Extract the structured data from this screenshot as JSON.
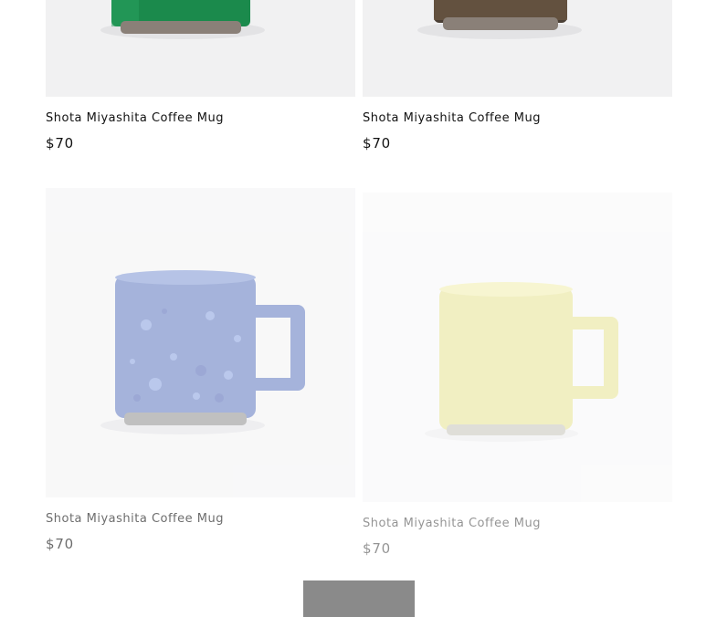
{
  "products": [
    {
      "title": "Shota Miyashita Coffee Mug",
      "price": "$70",
      "glaze": "green",
      "color": "#1b8a4c"
    },
    {
      "title": "Shota Miyashita Coffee Mug",
      "price": "$70",
      "glaze": "dark brown",
      "color": "#4a3f35"
    },
    {
      "title": "Shota Miyashita Coffee Mug",
      "price": "$70",
      "glaze": "blue speckled",
      "color": "#6f86c6"
    },
    {
      "title": "Shota Miyashita Coffee Mug",
      "price": "$70",
      "glaze": "pale yellow",
      "color": "#e2dc7a"
    }
  ],
  "load_more": {
    "label": ""
  }
}
